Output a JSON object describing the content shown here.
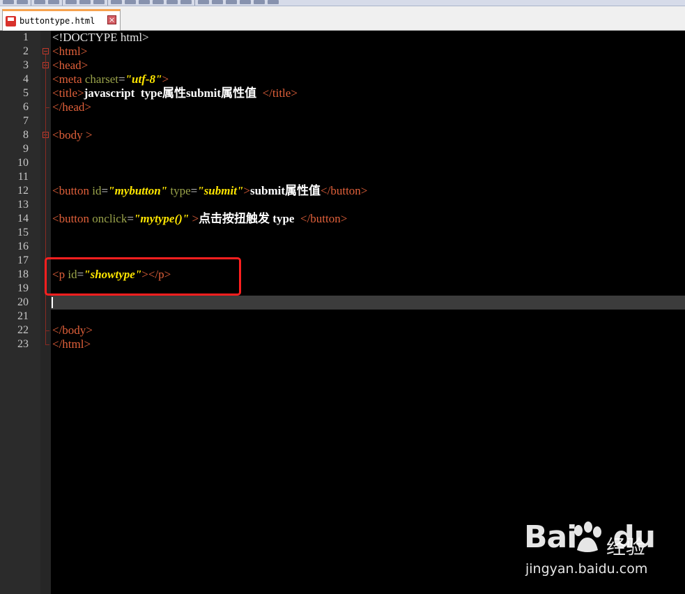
{
  "tab": {
    "filename": "buttontype.html",
    "close_glyph": "×"
  },
  "watermark": {
    "logo_left": "Bai",
    "logo_right": "du",
    "cn": "经验",
    "url": "jingyan.baidu.com"
  },
  "line_numbers": [
    "1",
    "2",
    "3",
    "4",
    "5",
    "6",
    "7",
    "8",
    "9",
    "10",
    "11",
    "12",
    "13",
    "14",
    "15",
    "16",
    "17",
    "18",
    "19",
    "20",
    "21",
    "22",
    "23"
  ],
  "code": {
    "l1": "<!DOCTYPE html>",
    "l2": "<html>",
    "l3": "<head>",
    "l4": {
      "open": "<meta",
      "attr": " charset",
      "eq": "=",
      "val": "\"utf-8\"",
      "close": ">"
    },
    "l5": {
      "open": "<title>",
      "text": "javascript  type属性submit属性值  ",
      "close": "</title>"
    },
    "l6": "</head>",
    "l8": "<body >",
    "l12": {
      "open": "<button",
      "attr1": " id",
      "eq1": "=",
      "val1": "\"mybutton\"",
      "attr2": " type",
      "eq2": "=",
      "val2": "\"submit\"",
      "gt": ">",
      "text": "submit属性值",
      "close": "</button>"
    },
    "l14": {
      "open": "<button",
      "attr": " onclick",
      "eq": "=",
      "val": "\"mytype()\"",
      "gt": " >",
      "text": "点击按扭触发 type  ",
      "close": "</button>"
    },
    "l18": {
      "open": "<p",
      "attr": " id",
      "eq": "=",
      "val": "\"showtype\"",
      "gt": ">",
      "close": "</p>"
    },
    "l22": "</body>",
    "l23": "</html>"
  },
  "colors": {
    "tag": "#e0603a",
    "attr": "#9aa34a",
    "string": "#ffe600",
    "text": "#ffffff",
    "background": "#000000",
    "highlight": "#ff1f1f",
    "tab_accent": "#f7a24d"
  },
  "icons": [
    "save-disk-icon",
    "close-tab-icon",
    "fold-marker-icon"
  ]
}
